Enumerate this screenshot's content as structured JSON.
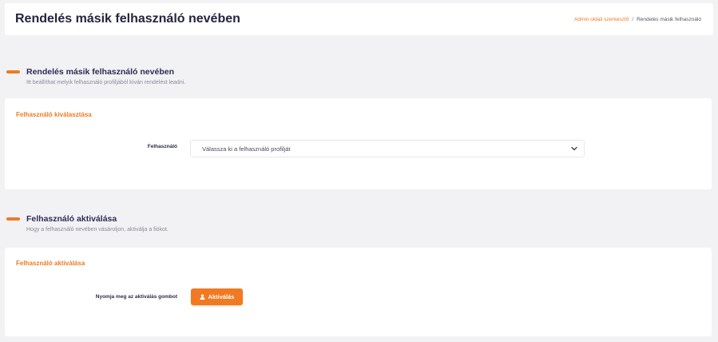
{
  "header": {
    "title": "Rendelés másik felhasználó nevében",
    "breadcrumb": {
      "link": "Admin oldali szerkesztő",
      "separator": "/",
      "current": "Rendelés másik felhasználó"
    }
  },
  "section1": {
    "title": "Rendelés másik felhasználó nevében",
    "description": "Itt beállíthat melyik felhasználó profiljából kíván rendelést leadni.",
    "card": {
      "title": "Felhasználó kiválasztása",
      "field_label": "Felhasználó",
      "select_value": "Válassza ki a felhasználó profilját"
    }
  },
  "section2": {
    "title": "Felhasználó aktiválása",
    "description": "Hogy a felhasználó nevében vásároljon, aktiválja a fiókot.",
    "card": {
      "title": "Felhasználó aktiválása",
      "field_label": "Nyomja meg az aktiválás gombot",
      "button_label": "Aktiválás",
      "button_icon": "user-icon"
    }
  },
  "colors": {
    "accent": "#f07a22",
    "background": "#f2f2f4",
    "title": "#23243f"
  }
}
